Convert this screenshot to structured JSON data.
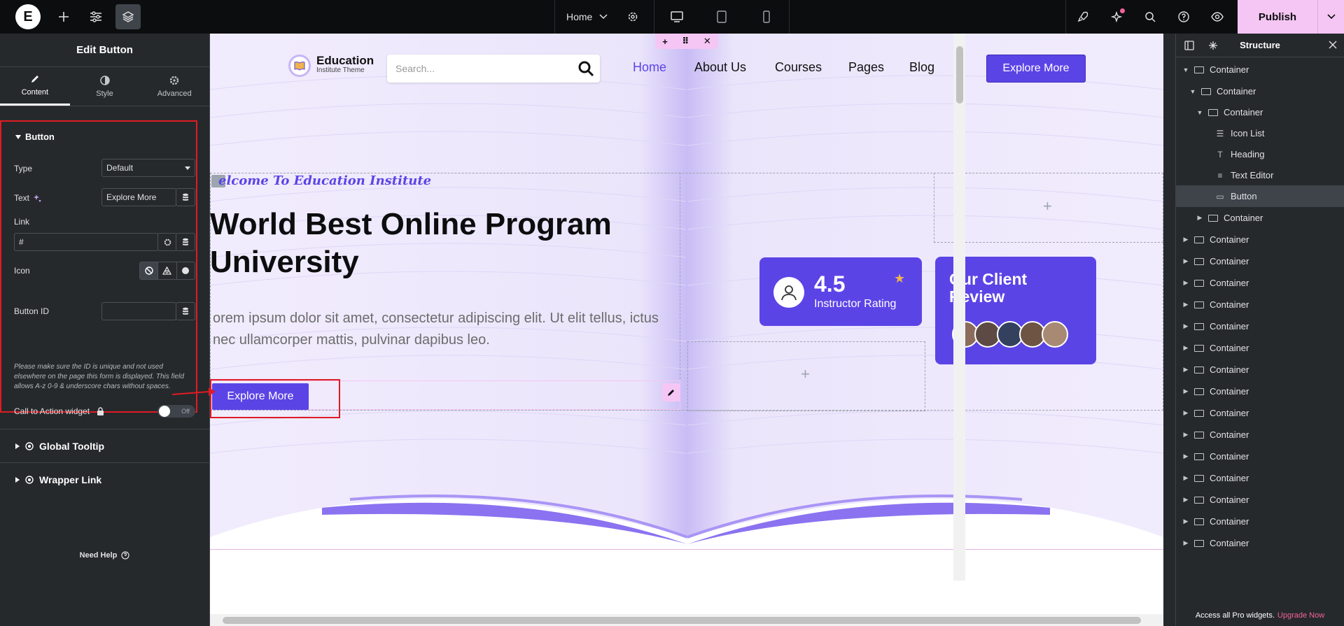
{
  "topbar": {
    "logo": "E",
    "page_name": "Home",
    "publish_label": "Publish"
  },
  "left_panel": {
    "title": "Edit Button",
    "tabs": [
      {
        "label": "Content"
      },
      {
        "label": "Style"
      },
      {
        "label": "Advanced"
      }
    ],
    "section_title": "Button",
    "type_label": "Type",
    "type_value": "Default",
    "text_label": "Text",
    "text_value": "Explore More",
    "link_label": "Link",
    "link_value": "#",
    "icon_label": "Icon",
    "button_id_label": "Button ID",
    "button_id_value": "",
    "button_id_note": "Please make sure the ID is unique and not used elsewhere on the page this form is displayed. This field allows A-z  0-9 & underscore chars without spaces.",
    "cta_label": "Call to Action widget",
    "cta_toggle": "Off",
    "global_tooltip": "Global Tooltip",
    "wrapper_link": "Wrapper Link",
    "need_help": "Need Help"
  },
  "site": {
    "logo_title": "Education",
    "logo_subtitle": "Institute Theme",
    "search_placeholder": "Search...",
    "nav": [
      "Home",
      "About Us",
      "Courses",
      "Pages",
      "Blog"
    ],
    "nav_button": "Explore More",
    "welcome": "elcome To Education Institute",
    "heading": "World Best Online Program University",
    "paragraph": "orem ipsum dolor sit amet, consectetur adipiscing elit. Ut elit tellus, ictus nec ullamcorper mattis, pulvinar dapibus leo.",
    "hero_button": "Explore More",
    "rating_value": "4.5",
    "rating_label": "Instructor Rating",
    "review_title": "Our Client Review"
  },
  "structure": {
    "title": "Structure",
    "items": [
      {
        "label": "Container",
        "type": "container"
      },
      {
        "label": "Container",
        "type": "container"
      },
      {
        "label": "Container",
        "type": "container"
      },
      {
        "label": "Icon List",
        "type": "icon-list"
      },
      {
        "label": "Heading",
        "type": "heading"
      },
      {
        "label": "Text Editor",
        "type": "text-editor"
      },
      {
        "label": "Button",
        "type": "button"
      },
      {
        "label": "Container",
        "type": "container"
      },
      {
        "label": "Container",
        "type": "container"
      },
      {
        "label": "Container",
        "type": "container"
      },
      {
        "label": "Container",
        "type": "container"
      },
      {
        "label": "Container",
        "type": "container"
      },
      {
        "label": "Container",
        "type": "container"
      },
      {
        "label": "Container",
        "type": "container"
      },
      {
        "label": "Container",
        "type": "container"
      },
      {
        "label": "Container",
        "type": "container"
      },
      {
        "label": "Container",
        "type": "container"
      },
      {
        "label": "Container",
        "type": "container"
      },
      {
        "label": "Container",
        "type": "container"
      },
      {
        "label": "Container",
        "type": "container"
      },
      {
        "label": "Container",
        "type": "container"
      },
      {
        "label": "Container",
        "type": "container"
      },
      {
        "label": "Container",
        "type": "container"
      }
    ],
    "footer_text": "Access all Pro widgets.",
    "footer_link": "Upgrade Now"
  },
  "colors": {
    "accent": "#5b44e6",
    "publish": "#f5c6f4",
    "highlight": "#e01b24"
  }
}
